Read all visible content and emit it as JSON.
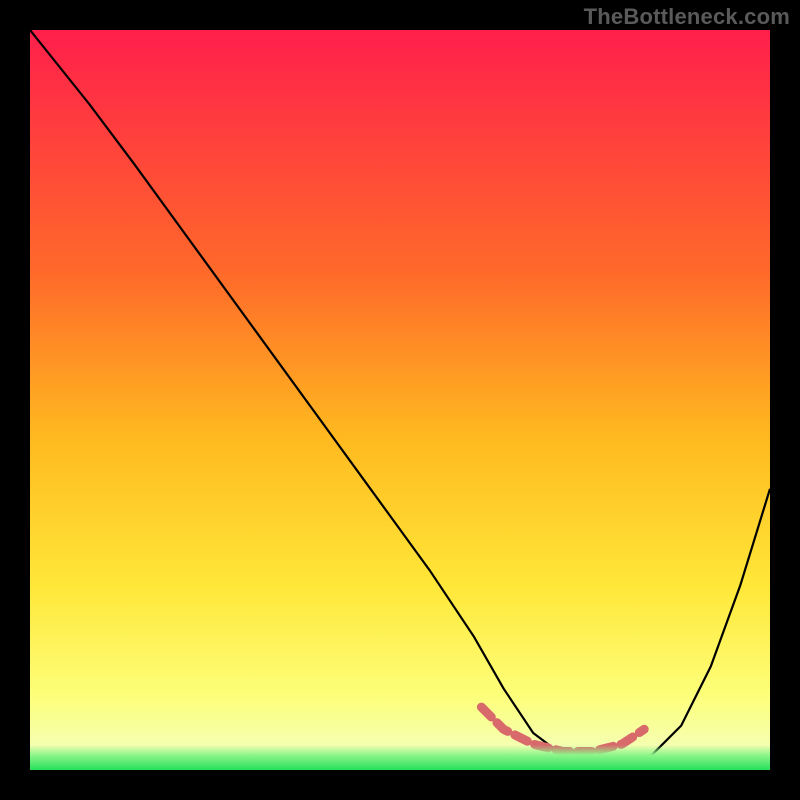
{
  "watermark": "TheBottleneck.com",
  "chart_data": {
    "type": "line",
    "title": "",
    "xlabel": "",
    "ylabel": "",
    "xlim": [
      0,
      100
    ],
    "ylim": [
      0,
      100
    ],
    "gradient_stops": [
      {
        "offset": 0,
        "color": "#ff1f4b"
      },
      {
        "offset": 33,
        "color": "#ff6a2a"
      },
      {
        "offset": 55,
        "color": "#ffb91f"
      },
      {
        "offset": 75,
        "color": "#ffe738"
      },
      {
        "offset": 90,
        "color": "#fdff7a"
      },
      {
        "offset": 100,
        "color": "#f0ffca"
      }
    ],
    "series": [
      {
        "name": "bottleneck-curve",
        "color": "#000000",
        "x": [
          0,
          4,
          8,
          14,
          22,
          30,
          38,
          46,
          54,
          60,
          64,
          68,
          72,
          76,
          80,
          84,
          88,
          92,
          96,
          100
        ],
        "y": [
          100,
          95,
          90,
          82,
          71,
          60,
          49,
          38,
          27,
          18,
          11,
          5,
          2,
          1,
          1,
          2,
          6,
          14,
          25,
          38
        ]
      },
      {
        "name": "sweet-spot-band",
        "color": "#d86a6c",
        "stroke_width": 9,
        "x": [
          61,
          64,
          68,
          72,
          76,
          80,
          83
        ],
        "y": [
          8.5,
          5.5,
          3.5,
          2.5,
          2.5,
          3.5,
          5.5
        ]
      }
    ]
  }
}
